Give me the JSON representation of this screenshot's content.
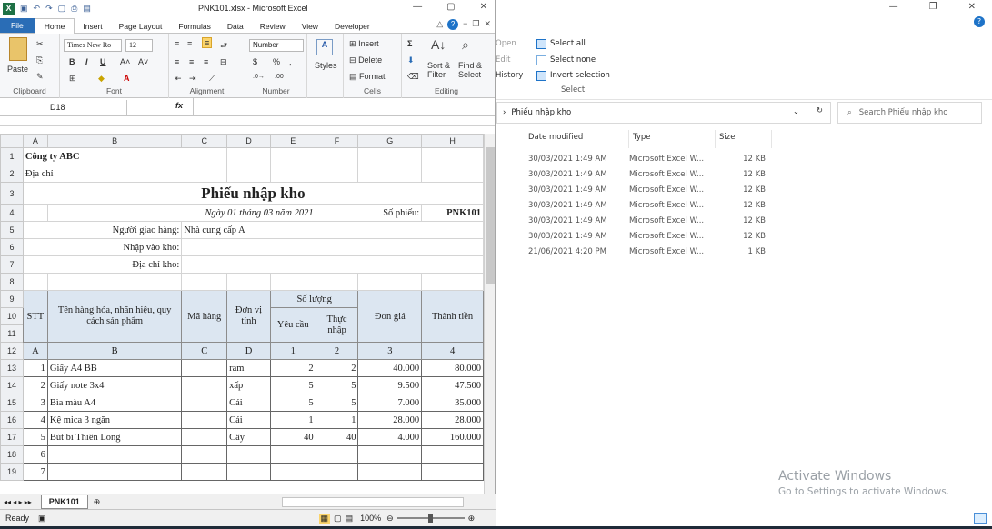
{
  "explorer": {
    "clipboard_items": [
      "Open",
      "Edit",
      "History"
    ],
    "select_items": [
      "Select all",
      "Select none",
      "Invert selection"
    ],
    "select_group": "Select",
    "path": "Phiếu nhập kho",
    "search_placeholder": "Search Phiếu nhập kho",
    "columns": [
      "Date modified",
      "Type",
      "Size"
    ],
    "rows": [
      {
        "date": "30/03/2021 1:49 AM",
        "type": "Microsoft Excel W...",
        "size": "12 KB"
      },
      {
        "date": "30/03/2021 1:49 AM",
        "type": "Microsoft Excel W...",
        "size": "12 KB"
      },
      {
        "date": "30/03/2021 1:49 AM",
        "type": "Microsoft Excel W...",
        "size": "12 KB"
      },
      {
        "date": "30/03/2021 1:49 AM",
        "type": "Microsoft Excel W...",
        "size": "12 KB"
      },
      {
        "date": "30/03/2021 1:49 AM",
        "type": "Microsoft Excel W...",
        "size": "12 KB"
      },
      {
        "date": "30/03/2021 1:49 AM",
        "type": "Microsoft Excel W...",
        "size": "12 KB"
      },
      {
        "date": "21/06/2021 4:20 PM",
        "type": "Microsoft Excel W...",
        "size": "1 KB"
      }
    ],
    "watermark1": "Activate Windows",
    "watermark2": "Go to Settings to activate Windows."
  },
  "excel": {
    "title": "PNK101.xlsx  -  Microsoft Excel",
    "tabs": [
      "File",
      "Home",
      "Insert",
      "Page Layout",
      "Formulas",
      "Data",
      "Review",
      "View",
      "Developer"
    ],
    "font_name": "Times New Ro",
    "font_size": "12",
    "number_format": "Number",
    "styles": "Styles",
    "insert": "Insert",
    "delete": "Delete",
    "format": "Format",
    "sort": "Sort &",
    "filter": "Filter",
    "find": "Find &",
    "select": "Select",
    "paste": "Paste",
    "groups": [
      "Clipboard",
      "Font",
      "Alignment",
      "Number",
      "Cells",
      "Editing"
    ],
    "name_box": "D18",
    "fx": "fx",
    "cols": [
      "",
      "A",
      "B",
      "C",
      "D",
      "E",
      "F",
      "G",
      "H"
    ],
    "sheet": {
      "company": "Công ty ABC",
      "address": "Địa chỉ",
      "title": "Phiếu nhập kho",
      "date": "Ngày 01 tháng 03 năm 2021",
      "so_phieu_label": "Số phiếu:",
      "so_phieu": "PNK101",
      "giao_hang_label": "Người giao hàng:",
      "giao_hang": "Nhà cung cấp A",
      "nhap_vao_label": "Nhập vào kho:",
      "dia_chi_kho_label": "Địa chỉ kho:",
      "h_stt": "STT",
      "h_ten": "Tên hàng hóa, nhãn hiệu, quy cách sản phẩm",
      "h_ma": "Mã hàng",
      "h_dvt": "Đơn vị tính",
      "h_soluong": "Số lượng",
      "h_yeucau": "Yêu cầu",
      "h_thucnhap": "Thực nhập",
      "h_dongia": "Đơn giá",
      "h_thanhtien": "Thành tiền",
      "idx": [
        "A",
        "B",
        "C",
        "D",
        "1",
        "2",
        "3",
        "4"
      ],
      "items": [
        {
          "stt": "1",
          "ten": "Giấy A4 BB",
          "dvt": "ram",
          "yc": "2",
          "tn": "2",
          "gia": "40.000",
          "tien": "80.000"
        },
        {
          "stt": "2",
          "ten": "Giấy note 3x4",
          "dvt": "xấp",
          "yc": "5",
          "tn": "5",
          "gia": "9.500",
          "tien": "47.500"
        },
        {
          "stt": "3",
          "ten": "Bìa màu A4",
          "dvt": "Cái",
          "yc": "5",
          "tn": "5",
          "gia": "7.000",
          "tien": "35.000"
        },
        {
          "stt": "4",
          "ten": "Kệ mica 3 ngăn",
          "dvt": "Cái",
          "yc": "1",
          "tn": "1",
          "gia": "28.000",
          "tien": "28.000"
        },
        {
          "stt": "5",
          "ten": "Bút bi Thiên Long",
          "dvt": "Cây",
          "yc": "40",
          "tn": "40",
          "gia": "4.000",
          "tien": "160.000"
        },
        {
          "stt": "6",
          "ten": "",
          "dvt": "",
          "yc": "",
          "tn": "",
          "gia": "",
          "tien": ""
        },
        {
          "stt": "7",
          "ten": "",
          "dvt": "",
          "yc": "",
          "tn": "",
          "gia": "",
          "tien": ""
        }
      ]
    },
    "sheet_tab": "PNK101",
    "status": "Ready",
    "zoom": "100%"
  }
}
